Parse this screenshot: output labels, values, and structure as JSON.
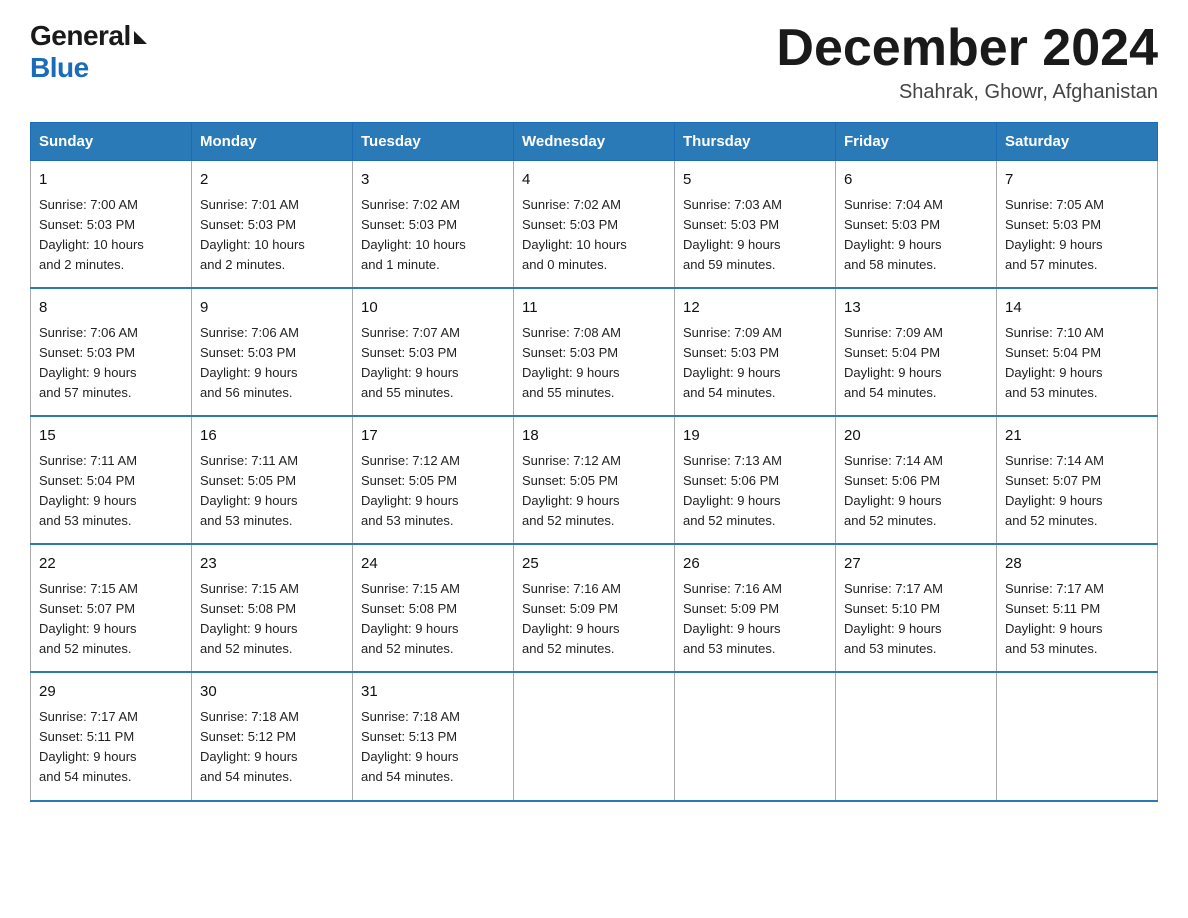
{
  "logo": {
    "general": "General",
    "blue": "Blue"
  },
  "title": "December 2024",
  "location": "Shahrak, Ghowr, Afghanistan",
  "days_of_week": [
    "Sunday",
    "Monday",
    "Tuesday",
    "Wednesday",
    "Thursday",
    "Friday",
    "Saturday"
  ],
  "weeks": [
    [
      {
        "day": "1",
        "info": "Sunrise: 7:00 AM\nSunset: 5:03 PM\nDaylight: 10 hours\nand 2 minutes."
      },
      {
        "day": "2",
        "info": "Sunrise: 7:01 AM\nSunset: 5:03 PM\nDaylight: 10 hours\nand 2 minutes."
      },
      {
        "day": "3",
        "info": "Sunrise: 7:02 AM\nSunset: 5:03 PM\nDaylight: 10 hours\nand 1 minute."
      },
      {
        "day": "4",
        "info": "Sunrise: 7:02 AM\nSunset: 5:03 PM\nDaylight: 10 hours\nand 0 minutes."
      },
      {
        "day": "5",
        "info": "Sunrise: 7:03 AM\nSunset: 5:03 PM\nDaylight: 9 hours\nand 59 minutes."
      },
      {
        "day": "6",
        "info": "Sunrise: 7:04 AM\nSunset: 5:03 PM\nDaylight: 9 hours\nand 58 minutes."
      },
      {
        "day": "7",
        "info": "Sunrise: 7:05 AM\nSunset: 5:03 PM\nDaylight: 9 hours\nand 57 minutes."
      }
    ],
    [
      {
        "day": "8",
        "info": "Sunrise: 7:06 AM\nSunset: 5:03 PM\nDaylight: 9 hours\nand 57 minutes."
      },
      {
        "day": "9",
        "info": "Sunrise: 7:06 AM\nSunset: 5:03 PM\nDaylight: 9 hours\nand 56 minutes."
      },
      {
        "day": "10",
        "info": "Sunrise: 7:07 AM\nSunset: 5:03 PM\nDaylight: 9 hours\nand 55 minutes."
      },
      {
        "day": "11",
        "info": "Sunrise: 7:08 AM\nSunset: 5:03 PM\nDaylight: 9 hours\nand 55 minutes."
      },
      {
        "day": "12",
        "info": "Sunrise: 7:09 AM\nSunset: 5:03 PM\nDaylight: 9 hours\nand 54 minutes."
      },
      {
        "day": "13",
        "info": "Sunrise: 7:09 AM\nSunset: 5:04 PM\nDaylight: 9 hours\nand 54 minutes."
      },
      {
        "day": "14",
        "info": "Sunrise: 7:10 AM\nSunset: 5:04 PM\nDaylight: 9 hours\nand 53 minutes."
      }
    ],
    [
      {
        "day": "15",
        "info": "Sunrise: 7:11 AM\nSunset: 5:04 PM\nDaylight: 9 hours\nand 53 minutes."
      },
      {
        "day": "16",
        "info": "Sunrise: 7:11 AM\nSunset: 5:05 PM\nDaylight: 9 hours\nand 53 minutes."
      },
      {
        "day": "17",
        "info": "Sunrise: 7:12 AM\nSunset: 5:05 PM\nDaylight: 9 hours\nand 53 minutes."
      },
      {
        "day": "18",
        "info": "Sunrise: 7:12 AM\nSunset: 5:05 PM\nDaylight: 9 hours\nand 52 minutes."
      },
      {
        "day": "19",
        "info": "Sunrise: 7:13 AM\nSunset: 5:06 PM\nDaylight: 9 hours\nand 52 minutes."
      },
      {
        "day": "20",
        "info": "Sunrise: 7:14 AM\nSunset: 5:06 PM\nDaylight: 9 hours\nand 52 minutes."
      },
      {
        "day": "21",
        "info": "Sunrise: 7:14 AM\nSunset: 5:07 PM\nDaylight: 9 hours\nand 52 minutes."
      }
    ],
    [
      {
        "day": "22",
        "info": "Sunrise: 7:15 AM\nSunset: 5:07 PM\nDaylight: 9 hours\nand 52 minutes."
      },
      {
        "day": "23",
        "info": "Sunrise: 7:15 AM\nSunset: 5:08 PM\nDaylight: 9 hours\nand 52 minutes."
      },
      {
        "day": "24",
        "info": "Sunrise: 7:15 AM\nSunset: 5:08 PM\nDaylight: 9 hours\nand 52 minutes."
      },
      {
        "day": "25",
        "info": "Sunrise: 7:16 AM\nSunset: 5:09 PM\nDaylight: 9 hours\nand 52 minutes."
      },
      {
        "day": "26",
        "info": "Sunrise: 7:16 AM\nSunset: 5:09 PM\nDaylight: 9 hours\nand 53 minutes."
      },
      {
        "day": "27",
        "info": "Sunrise: 7:17 AM\nSunset: 5:10 PM\nDaylight: 9 hours\nand 53 minutes."
      },
      {
        "day": "28",
        "info": "Sunrise: 7:17 AM\nSunset: 5:11 PM\nDaylight: 9 hours\nand 53 minutes."
      }
    ],
    [
      {
        "day": "29",
        "info": "Sunrise: 7:17 AM\nSunset: 5:11 PM\nDaylight: 9 hours\nand 54 minutes."
      },
      {
        "day": "30",
        "info": "Sunrise: 7:18 AM\nSunset: 5:12 PM\nDaylight: 9 hours\nand 54 minutes."
      },
      {
        "day": "31",
        "info": "Sunrise: 7:18 AM\nSunset: 5:13 PM\nDaylight: 9 hours\nand 54 minutes."
      },
      null,
      null,
      null,
      null
    ]
  ]
}
